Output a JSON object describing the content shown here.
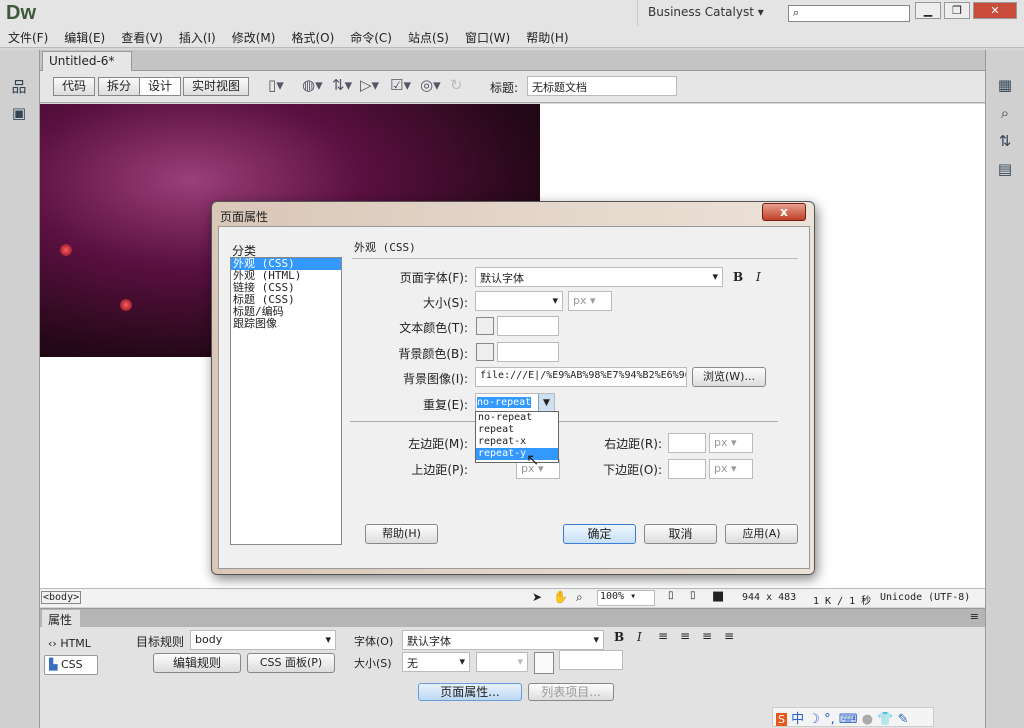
{
  "app": {
    "logo": "Dw",
    "workspace": "Business Catalyst",
    "search_placeholder": ""
  },
  "menu": [
    "文件(F)",
    "编辑(E)",
    "查看(V)",
    "插入(I)",
    "修改(M)",
    "格式(O)",
    "命令(C)",
    "站点(S)",
    "窗口(W)",
    "帮助(H)"
  ],
  "document": {
    "tab": "Untitled-6*",
    "close": "×"
  },
  "toolbar": {
    "views": [
      "代码",
      "拆分",
      "设计",
      "实时视图"
    ],
    "active_view": "设计",
    "title_label": "标题:",
    "title_value": "无标题文档"
  },
  "status": {
    "tag": "<body>",
    "zoom": "100%",
    "dimensions": "944 x 483",
    "size_time": "1 K / 1 秒",
    "encoding": "Unicode (UTF-8)"
  },
  "properties": {
    "tab": "属性",
    "html": "HTML",
    "css": "CSS",
    "target_rule_label": "目标规则",
    "target_rule": "body",
    "edit_rule": "编辑规则",
    "css_panel": "CSS 面板(P)",
    "font_label": "字体(O)",
    "font": "默认字体",
    "size_label": "大小(S)",
    "size": "无",
    "page_props": "页面属性...",
    "list_item": "列表项目..."
  },
  "dialog": {
    "title": "页面属性",
    "close": "x",
    "category_label": "分类",
    "categories": [
      "外观 (CSS)",
      "外观 (HTML)",
      "链接 (CSS)",
      "标题 (CSS)",
      "标题/编码",
      "跟踪图像"
    ],
    "selected_category": "外观 (CSS)",
    "section": "外观 (CSS)",
    "page_font_label": "页面字体(F):",
    "page_font": "默认字体",
    "size_label": "大小(S):",
    "size_unit": "px",
    "text_color_label": "文本颜色(T):",
    "bg_color_label": "背景颜色(B):",
    "bg_image_label": "背景图像(I):",
    "bg_image": "file:///E|/%E9%AB%98%E7%94%B2%E6%96",
    "browse": "浏览(W)...",
    "repeat_label": "重复(E):",
    "repeat": "no-repeat",
    "repeat_options": [
      "no-repeat",
      "repeat",
      "repeat-x",
      "repeat-y"
    ],
    "highlighted_option": "repeat-y",
    "left_margin_label": "左边距(M):",
    "right_margin_label": "右边距(R):",
    "top_margin_label": "上边距(P):",
    "bottom_margin_label": "下边距(O):",
    "margin_unit": "px",
    "help": "帮助(H)",
    "ok": "确定",
    "cancel": "取消",
    "apply": "应用(A)"
  },
  "taskbar": {
    "ime": "中"
  }
}
